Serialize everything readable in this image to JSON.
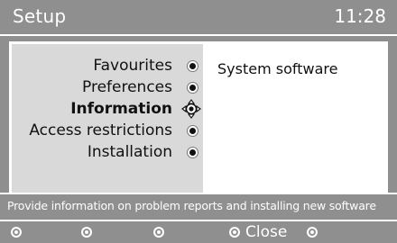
{
  "header": {
    "title": "Setup",
    "clock": "11:28"
  },
  "menu": {
    "items": [
      {
        "label": "Favourites",
        "selected": false
      },
      {
        "label": "Preferences",
        "selected": false
      },
      {
        "label": "Information",
        "selected": true
      },
      {
        "label": "Access restrictions",
        "selected": false
      },
      {
        "label": "Installation",
        "selected": false
      }
    ]
  },
  "submenu": {
    "items": [
      {
        "label": "System software"
      }
    ]
  },
  "info_bar": {
    "text": "Provide information on problem reports and installing new software"
  },
  "color_keys": [
    {
      "label": ""
    },
    {
      "label": ""
    },
    {
      "label": ""
    },
    {
      "label": "Close"
    },
    {
      "label": ""
    }
  ],
  "colors": {
    "background": "#8f8f8f",
    "menu_panel": "#d9d9d9",
    "text": "#111111",
    "bar_text": "#ffffff"
  },
  "icons": {
    "navigation": "navigation-cross-icon",
    "bullet": "radio-bullet-icon",
    "key": "color-key-dot-icon"
  }
}
